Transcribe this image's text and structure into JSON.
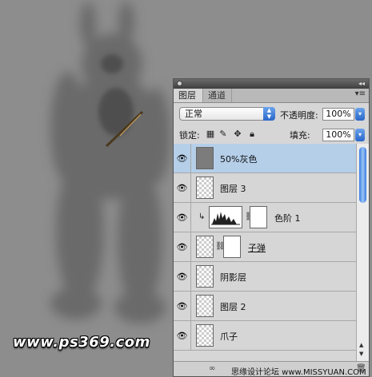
{
  "watermark": "www.ps369.com",
  "panel": {
    "tabs": [
      "图层",
      "通道"
    ],
    "blend_mode": "正常",
    "opacity_label": "不透明度:",
    "opacity_value": "100%",
    "lock_label": "锁定:",
    "fill_label": "填充:",
    "fill_value": "100%",
    "layers": [
      {
        "name": "50%灰色",
        "selected": true,
        "thumb": "gray"
      },
      {
        "name": "图层 3",
        "selected": false,
        "thumb": "transparent"
      },
      {
        "name": "色阶 1",
        "selected": false,
        "thumb": "levels"
      },
      {
        "name": "子弹",
        "selected": false,
        "thumb": "masked"
      },
      {
        "name": "阴影层",
        "selected": false,
        "thumb": "transparent"
      },
      {
        "name": "图层 2",
        "selected": false,
        "thumb": "transparent"
      },
      {
        "name": "爪子",
        "selected": false,
        "thumb": "transparent"
      }
    ],
    "footer_watermark": "思缘设计论坛 www.MISSYUAN.COM"
  }
}
